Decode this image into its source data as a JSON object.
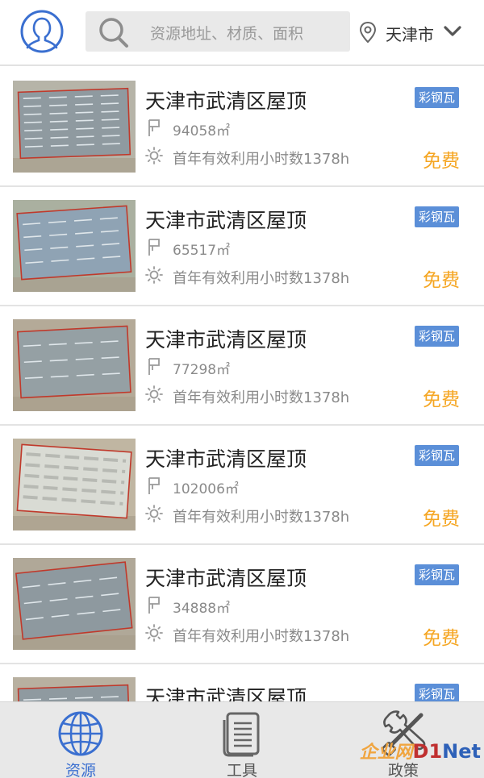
{
  "header": {
    "avatar_icon": "user-profile-icon",
    "search": {
      "icon": "search-icon",
      "placeholder": "资源地址、材质、面积"
    },
    "location": {
      "icon": "location-pin-icon",
      "city": "天津市",
      "dropdown_icon": "chevron-down-icon"
    }
  },
  "listings": [
    {
      "title": "天津市武清区屋顶",
      "tag": "彩钢瓦",
      "area": "94058㎡",
      "hours": "首年有效利用小时数1378h",
      "price": "免费"
    },
    {
      "title": "天津市武清区屋顶",
      "tag": "彩钢瓦",
      "area": "65517㎡",
      "hours": "首年有效利用小时数1378h",
      "price": "免费"
    },
    {
      "title": "天津市武清区屋顶",
      "tag": "彩钢瓦",
      "area": "77298㎡",
      "hours": "首年有效利用小时数1378h",
      "price": "免费"
    },
    {
      "title": "天津市武清区屋顶",
      "tag": "彩钢瓦",
      "area": "102006㎡",
      "hours": "首年有效利用小时数1378h",
      "price": "免费"
    },
    {
      "title": "天津市武清区屋顶",
      "tag": "彩钢瓦",
      "area": "34888㎡",
      "hours": "首年有效利用小时数1378h",
      "price": "免费"
    },
    {
      "title": "天津市武清区屋顶",
      "tag": "彩钢瓦",
      "area": "",
      "hours": "",
      "price": ""
    }
  ],
  "tabs": [
    {
      "label": "资源",
      "icon": "globe-icon",
      "active": true
    },
    {
      "label": "工具",
      "icon": "document-icon",
      "active": false
    },
    {
      "label": "政策",
      "icon": "tools-icon",
      "active": false
    }
  ],
  "watermark": {
    "cn": "企业网",
    "d1": "D1",
    "net": "Net"
  },
  "colors": {
    "accent": "#3a6fd0",
    "tag_bg": "#5b8fd8",
    "price": "#f5a623",
    "tabbar_bg": "#e8e8e8"
  }
}
